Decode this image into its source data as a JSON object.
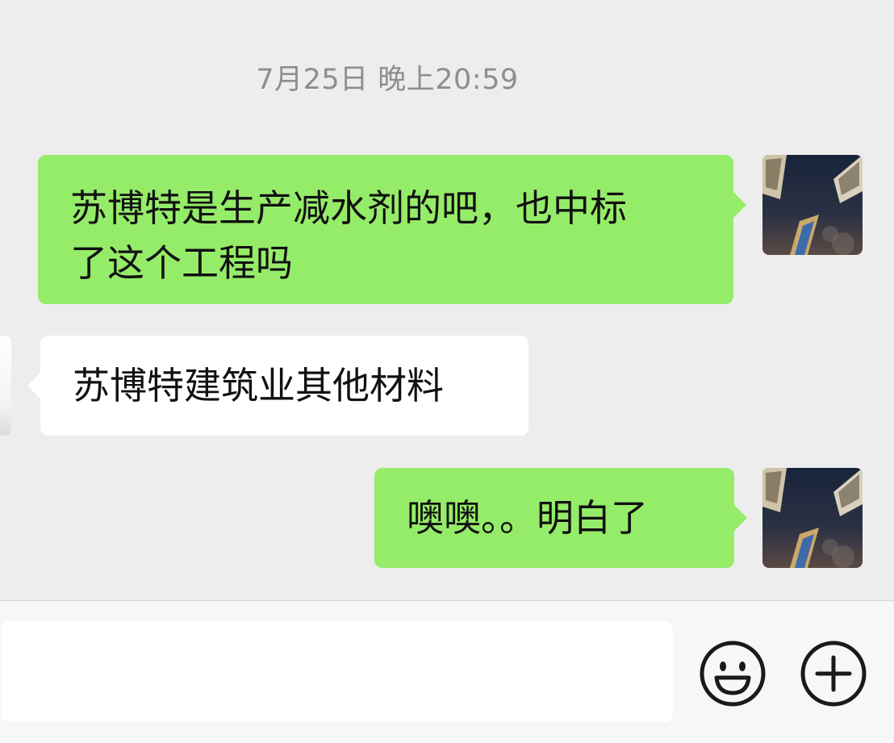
{
  "chat": {
    "timestamp": "7月25日 晚上20:59",
    "messages": [
      {
        "direction": "out",
        "text_lines": [
          "苏博特是生产减水剂的吧，也中标",
          "了这个工程吗"
        ]
      },
      {
        "direction": "in",
        "text": "苏博特建筑业其他材料"
      },
      {
        "direction": "out",
        "text": "噢噢。。明白了"
      }
    ]
  },
  "input_bar": {
    "value": "",
    "placeholder": "",
    "emoji_icon": "emoji-smile-icon",
    "more_icon": "plus-circle-icon"
  },
  "colors": {
    "outgoing_bubble": "#95ec69",
    "incoming_bubble": "#ffffff",
    "background": "#ededed",
    "timestamp_text": "#8e8e8e"
  }
}
